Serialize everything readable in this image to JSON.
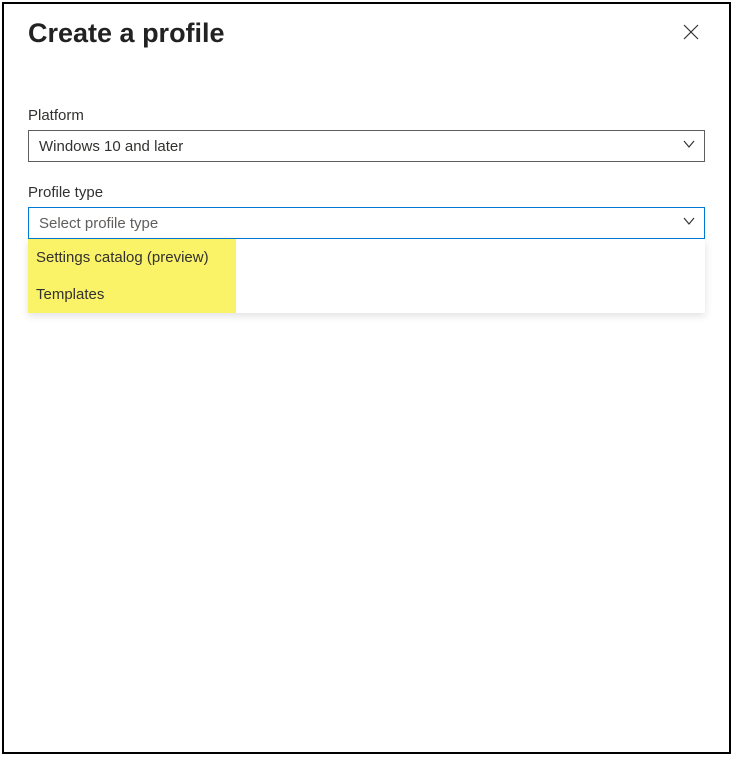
{
  "header": {
    "title": "Create a profile"
  },
  "platform": {
    "label": "Platform",
    "value": "Windows 10 and later"
  },
  "profileType": {
    "label": "Profile type",
    "placeholder": "Select profile type",
    "options": [
      "Settings catalog (preview)",
      "Templates"
    ]
  }
}
